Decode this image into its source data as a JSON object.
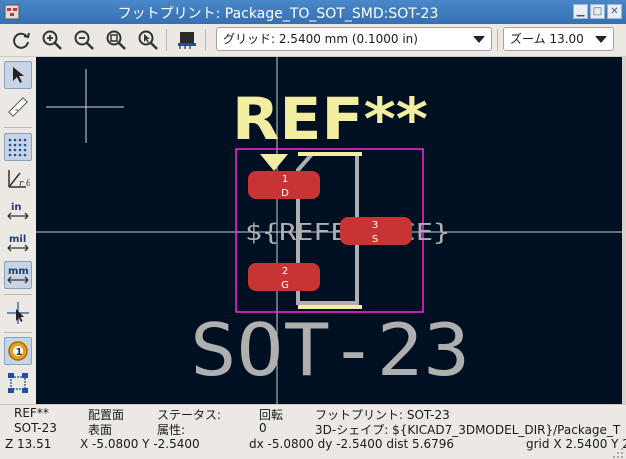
{
  "window": {
    "title": "フットプリント: Package_TO_SOT_SMD:SOT-23",
    "minimize": "▁",
    "maximize": "□",
    "close": "✕"
  },
  "toolbar": {
    "grid": "グリッド: 2.5400 mm (0.1000 in)",
    "zoom": "ズーム 13.00",
    "icons": [
      "redraw-icon",
      "zoom-in-icon",
      "zoom-out-icon",
      "zoom-fit-icon",
      "zoom-selection-icon",
      "3d-viewer-icon"
    ]
  },
  "left_toolbar": {
    "icons": [
      "select-arrow-icon",
      "measure-ruler-icon",
      "grid-dots-icon",
      "polar-coords-icon",
      "units-inch-icon",
      "units-mil-icon",
      "units-mm-icon",
      "cursor-crosshair-icon",
      "pad-numbers-icon",
      "pad-sketch-icon"
    ],
    "units_in": "in",
    "units_mil": "mil",
    "units_mm": "mm"
  },
  "board": {
    "ref_text": "REF**",
    "value_text": "SOT-23",
    "fab_text": "${REFERENCE}",
    "pads": [
      {
        "number": "1",
        "net": "D"
      },
      {
        "number": "2",
        "net": "G"
      },
      {
        "number": "3",
        "net": "S"
      }
    ],
    "colors": {
      "background": "#001023",
      "silk": "#f2eda1",
      "fab": "#afafaf",
      "courtyard": "#ff26e2",
      "pad": "#c83434",
      "cursor": "#cccccc"
    }
  },
  "status": {
    "row1": {
      "ref": "REF**",
      "placement_label": "配置面",
      "status_label": "ステータス:",
      "rotation_label": "回転",
      "footprint": "フットプリント: SOT-23"
    },
    "row2": {
      "value": "SOT-23",
      "placement_value": "表面",
      "attributes_label": "属性:",
      "rotation_value": "0",
      "shape3d": "3D-シェイプ: ${KICAD7_3DMODEL_DIR}/Package_T"
    },
    "row3": {
      "zoom": "Z 13.51",
      "xy": "X -5.0800  Y -2.5400",
      "delta": "dx -5.0800  dy -2.5400  dist 5.6796",
      "grid": "grid X 2.5400  Y 2"
    }
  }
}
